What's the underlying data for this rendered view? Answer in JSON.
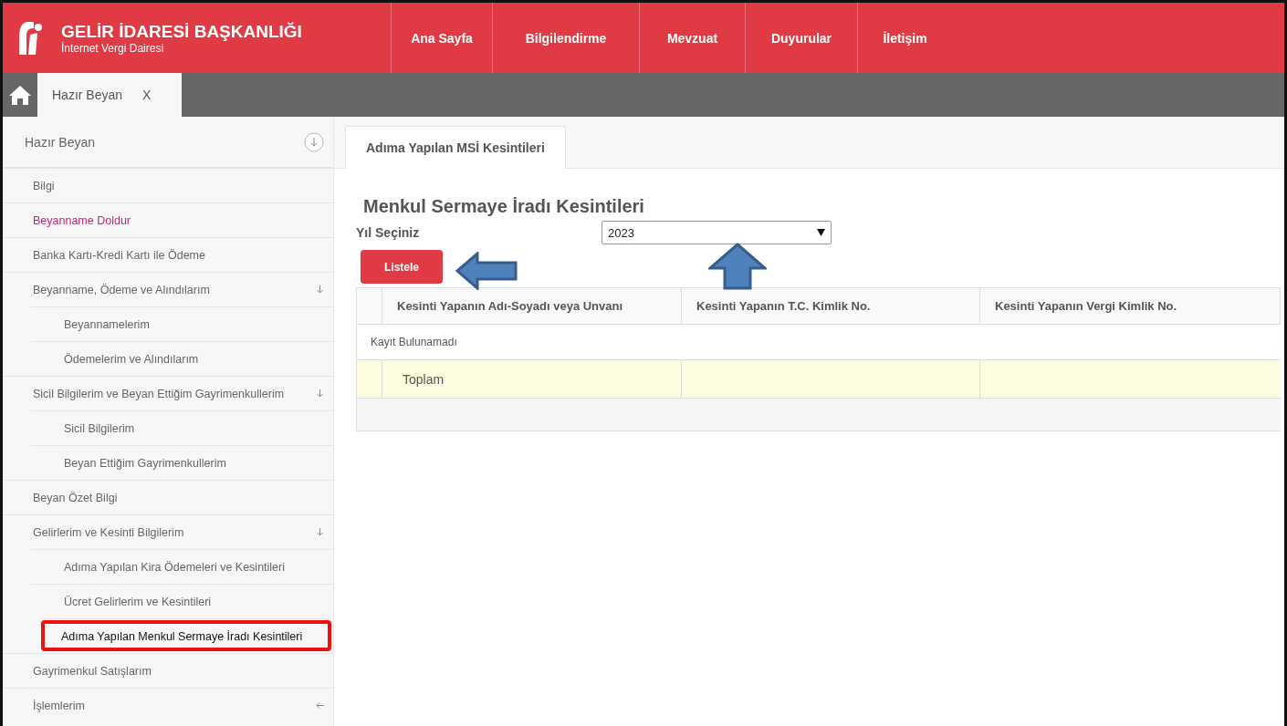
{
  "header": {
    "title": "GELİR İDARESİ BAŞKANLIĞI",
    "subtitle": "İnternet Vergi Dairesi",
    "nav": [
      {
        "label": "Ana Sayfa"
      },
      {
        "label": "Bilgilendirme"
      },
      {
        "label": "Mevzuat"
      },
      {
        "label": "Duyurular"
      },
      {
        "label": "İletişim"
      }
    ]
  },
  "tabs": [
    {
      "label": "Hazır Beyan",
      "close": "X",
      "selected": true
    }
  ],
  "sidebar": {
    "title": "Hazır Beyan",
    "items": [
      {
        "label": "Bilgi",
        "highlighted": false,
        "selected": false
      },
      {
        "label": "Beyanname Doldur",
        "highlighted": true,
        "selected": false
      },
      {
        "label": "Banka Kartı-Kredi Kartı ile Ödeme",
        "highlighted": false,
        "selected": false
      },
      {
        "label": "Beyanname, Ödeme ve Alındılarım",
        "highlighted": false,
        "selected": false,
        "expanded": true,
        "children": [
          {
            "label": "Beyannamelerim",
            "highlighted": false,
            "selected": false
          },
          {
            "label": "Ödemelerim ve Alındılarım",
            "highlighted": false,
            "selected": false
          }
        ]
      },
      {
        "label": "Sicil Bilgilerim ve Beyan Ettiğim Gayrimenkullerim",
        "highlighted": false,
        "selected": false,
        "expanded": true,
        "children": [
          {
            "label": "Sicil Bilgilerim",
            "highlighted": false,
            "selected": false
          },
          {
            "label": "Beyan Ettiğim Gayrimenkullerim",
            "highlighted": false,
            "selected": false
          }
        ]
      },
      {
        "label": "Beyan Özet Bilgi",
        "highlighted": false,
        "selected": false
      },
      {
        "label": "Gelirlerim ve Kesinti Bilgilerim",
        "highlighted": false,
        "selected": false,
        "expanded": true,
        "children": [
          {
            "label": "Adıma Yapılan Kira Ödemeleri ve Kesintileri",
            "highlighted": false,
            "selected": false
          },
          {
            "label": "Ücret Gelirlerim ve Kesintileri",
            "highlighted": false,
            "selected": false
          },
          {
            "label": "Adıma Yapılan Menkul Sermaye İradı Kesintileri",
            "highlighted": false,
            "selected": true
          }
        ]
      },
      {
        "label": "Gayrimenkul Satışlarım",
        "highlighted": false,
        "selected": false
      },
      {
        "label": "İşlemlerim",
        "highlighted": false,
        "selected": false,
        "expanded": false
      }
    ]
  },
  "content_tabs": [
    {
      "label": "Adıma Yapılan MSİ Kesintileri",
      "selected": true
    }
  ],
  "page_title": "Menkul Sermaye İradı Kesintileri",
  "year_field": {
    "label": "Yıl Seçiniz",
    "value": "2023"
  },
  "list_button": "Listele",
  "table": {
    "columns": [
      "Kesinti Yapanın Adı-Soyadı veya Unvanı",
      "Kesinti Yapanın T.C. Kimlik No.",
      "Kesinti Yapanın Vergi Kimlik No."
    ],
    "empty_message": "Kayıt Bulunamadı",
    "total_label": "Toplam"
  }
}
